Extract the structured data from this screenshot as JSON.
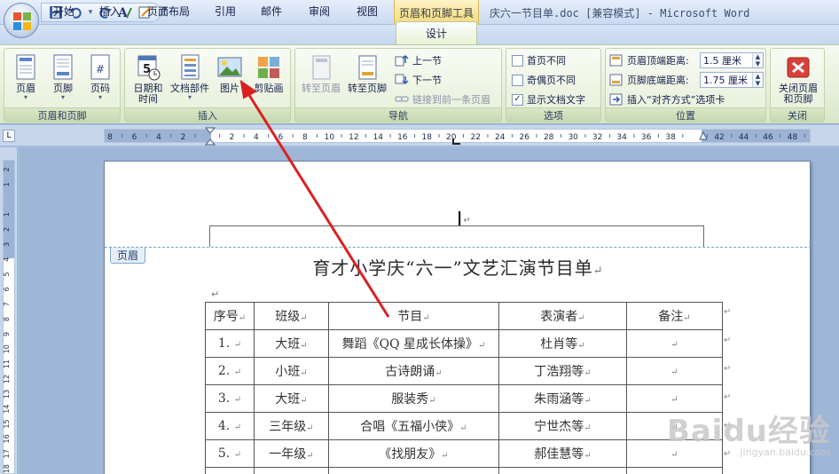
{
  "titlebar": {
    "context_tab_title": "页眉和页脚工具",
    "window_title": "庆六一节目单.doc [兼容模式] - Microsoft Word"
  },
  "tabs": [
    {
      "label": "开始"
    },
    {
      "label": "插入"
    },
    {
      "label": "页面布局"
    },
    {
      "label": "引用"
    },
    {
      "label": "邮件"
    },
    {
      "label": "审阅"
    },
    {
      "label": "视图"
    },
    {
      "label": "设计",
      "active": true
    }
  ],
  "ribbon": {
    "groups": {
      "header_footer": {
        "label": "页眉和页脚",
        "buttons": {
          "header": "页眉",
          "footer": "页脚",
          "page_number": "页码"
        }
      },
      "insert": {
        "label": "插入",
        "buttons": {
          "datetime_1": "日期和",
          "datetime_2": "时间",
          "parts": "文档部件",
          "picture": "图片",
          "clipart": "剪贴画"
        }
      },
      "navigation": {
        "label": "导航",
        "buttons": {
          "goto_header": "转至页眉",
          "goto_footer": "转至页脚",
          "prev_section": "上一节",
          "next_section": "下一节",
          "link_previous": "链接到前一条页眉"
        }
      },
      "options": {
        "label": "选项",
        "items": {
          "first_page": "首页不同",
          "odd_even": "奇偶页不同",
          "show_text": "显示文档文字"
        },
        "checked": {
          "first_page": false,
          "odd_even": false,
          "show_text": true
        },
        "check_mark": "✓"
      },
      "position": {
        "label": "位置",
        "header_top_label": "页眉顶端距离:",
        "header_top_value": "1.5 厘米",
        "footer_bottom_label": "页脚底端距离:",
        "footer_bottom_value": "1.75 厘米",
        "insert_align_tab": "插入“对齐方式”选项卡"
      },
      "close": {
        "label": "关闭",
        "button_1": "关闭页眉",
        "button_2": "和页脚"
      }
    }
  },
  "ruler": {
    "corner": "L",
    "h_ticks": [
      "8",
      "6",
      "4",
      "2",
      "",
      "2",
      "4",
      "6",
      "8",
      "10",
      "12",
      "14",
      "16",
      "18",
      "20",
      "22",
      "24",
      "26",
      "28",
      "30",
      "32",
      "34",
      "36",
      "38",
      "",
      "42",
      "44",
      "46",
      "48"
    ],
    "v_ticks": [
      "2",
      "1",
      "",
      "1",
      "2",
      "3",
      "4",
      "5",
      "6",
      "7",
      "8",
      "9",
      "10",
      "11",
      "12",
      "13",
      "14",
      "15",
      "16",
      "17",
      "18"
    ]
  },
  "document": {
    "header_tag": "页眉",
    "title": "育才小学庆“六一”文艺汇演节目单",
    "table": {
      "headers": [
        "序号",
        "班级",
        "节目",
        "表演者",
        "备注"
      ],
      "rows": [
        [
          "1.",
          "大班",
          "舞蹈《QQ 星成长体操》",
          "杜肖等",
          ""
        ],
        [
          "2.",
          "小班",
          "古诗朗诵",
          "丁浩翔等",
          ""
        ],
        [
          "3.",
          "大班",
          "服装秀",
          "朱雨涵等",
          ""
        ],
        [
          "4.",
          "三年级",
          "合唱《五福小侠》",
          "宁世杰等",
          ""
        ],
        [
          "5.",
          "一年级",
          "《找朋友》",
          "郝佳慧等",
          ""
        ]
      ]
    }
  },
  "marks": {
    "paragraph": "↵"
  },
  "watermark": {
    "brand": "Baidu经验",
    "url": "jingyan.baidu.com"
  },
  "colors": {
    "annotation_arrow": "#d92121",
    "context_tab": "#f3d977",
    "ribbon_bg": "#e6efd9"
  }
}
